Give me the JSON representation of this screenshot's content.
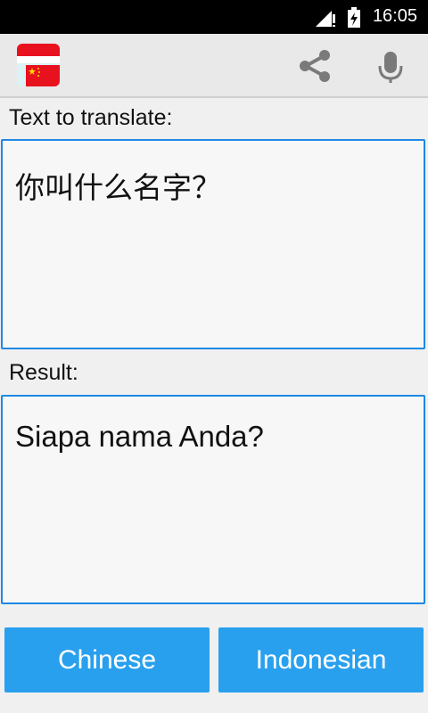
{
  "status_bar": {
    "time": "16:05",
    "icons": [
      "signal-icon",
      "battery-charging-icon"
    ]
  },
  "app_bar": {
    "logo_icon": "indonesia-china-flags-icon",
    "actions": [
      "share-icon",
      "microphone-icon"
    ]
  },
  "input": {
    "label": "Text to translate:",
    "text": "你叫什么名字？"
  },
  "output": {
    "label": "Result:",
    "text": "Siapa nama Anda?"
  },
  "languages": {
    "source": "Chinese",
    "target": "Indonesian"
  },
  "colors": {
    "accent": "#29a0ee",
    "border": "#1e88e5"
  }
}
